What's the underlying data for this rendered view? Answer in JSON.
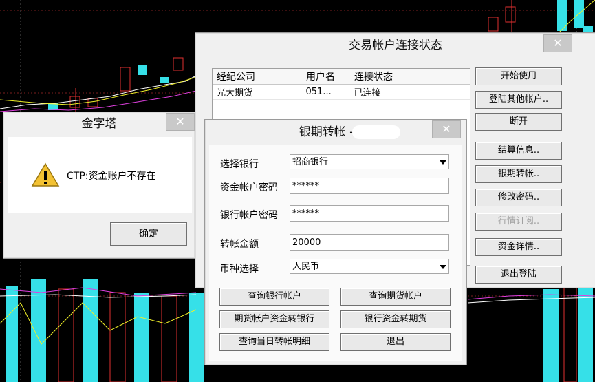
{
  "conn_dialog": {
    "title": "交易帐户连接状态",
    "close": "✕",
    "columns": [
      "经纪公司",
      "用户名",
      "连接状态"
    ],
    "rows": [
      [
        "光大期货",
        "051...",
        "已连接"
      ]
    ],
    "buttons": [
      "开始使用",
      "登陆其他帐户..",
      "断开",
      "结算信息..",
      "银期转帐..",
      "修改密码..",
      "行情订阅..",
      "资金详情..",
      "退出登陆"
    ]
  },
  "jzt_dialog": {
    "title": "金字塔",
    "close": "✕",
    "message": "CTP:资金账户不存在",
    "ok": "确定"
  },
  "transfer_dialog": {
    "title": "银期转帐 - 05",
    "close": "✕",
    "bank_label": "选择银行",
    "bank_value": "招商银行",
    "fund_pwd_label": "资金帐户密码",
    "fund_pwd_value": "******",
    "bank_pwd_label": "银行帐户密码",
    "bank_pwd_value": "******",
    "amount_label": "转帐金额",
    "amount_value": "20000",
    "currency_label": "币种选择",
    "currency_value": "人民币",
    "buttons": {
      "query_bank": "查询银行帐户",
      "query_futures": "查询期货帐户",
      "futures_to_bank": "期货帐户资金转银行",
      "bank_to_futures": "银行资金转期货",
      "query_today": "查询当日转帐明细",
      "exit": "退出"
    }
  }
}
